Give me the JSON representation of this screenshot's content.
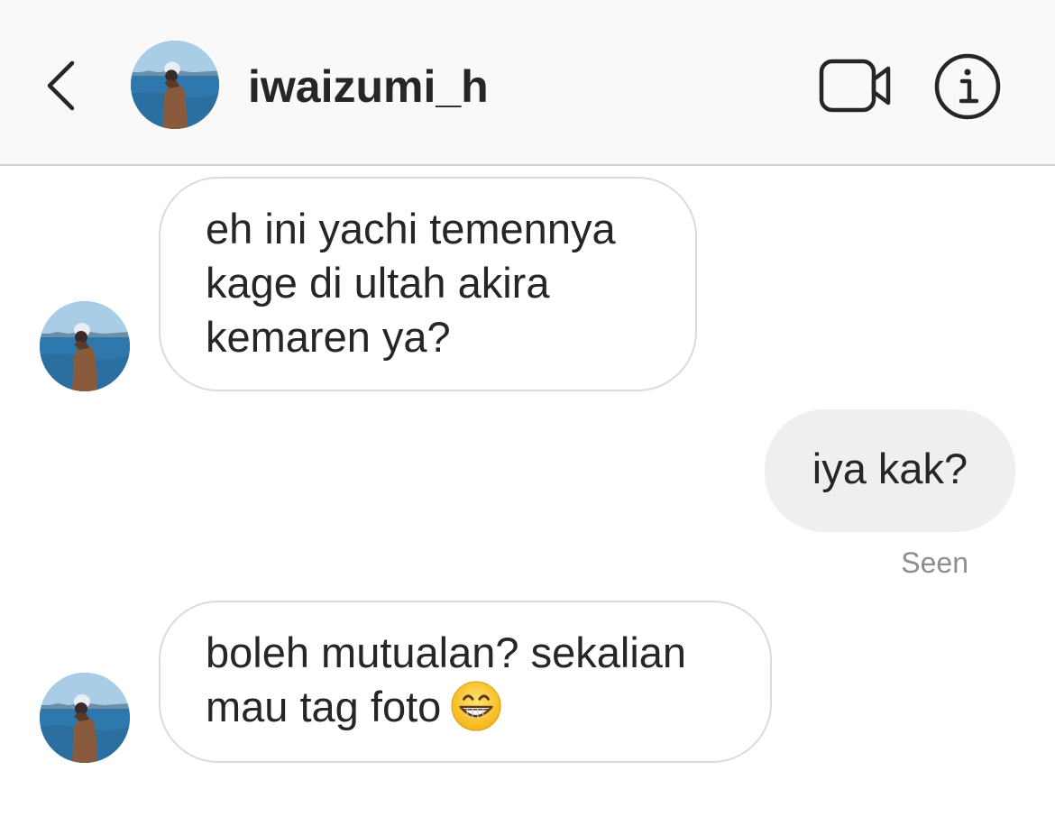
{
  "header": {
    "username": "iwaizumi_h",
    "back_icon": "chevron-left-icon",
    "video_icon": "video-camera-icon",
    "info_icon": "info-icon"
  },
  "messages": [
    {
      "direction": "incoming",
      "lines": [
        "eh ini yachi temennya",
        "kage di ultah akira",
        "kemaren ya?"
      ]
    },
    {
      "direction": "outgoing",
      "lines": [
        "iya kak?"
      ],
      "status": "Seen"
    },
    {
      "direction": "incoming",
      "lines": [
        "boleh mutualan? sekalian",
        "mau tag foto"
      ],
      "emoji": "grinning-face-with-smiling-eyes"
    }
  ],
  "colors": {
    "header_bg": "#f9f9f9",
    "incoming_border": "#dbdbdb",
    "outgoing_bg": "#efefef",
    "seen_text": "#8e8e8e"
  }
}
